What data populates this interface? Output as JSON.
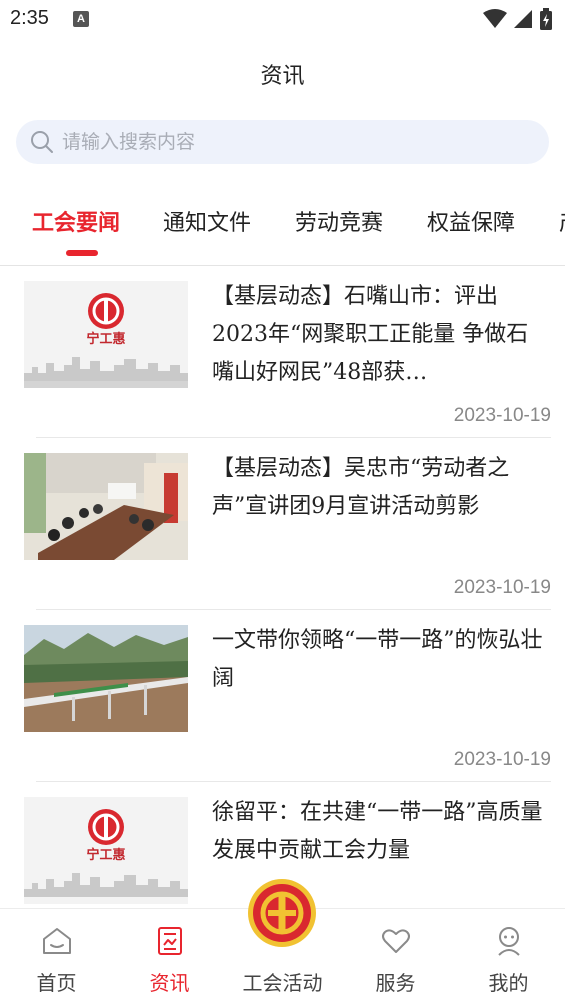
{
  "status_bar": {
    "time": "2:35",
    "badge": "A"
  },
  "header": {
    "title": "资讯"
  },
  "search": {
    "placeholder": "请输入搜索内容"
  },
  "tabs": [
    {
      "label": "工会要闻",
      "active": true
    },
    {
      "label": "通知文件",
      "active": false
    },
    {
      "label": "劳动竞赛",
      "active": false
    },
    {
      "label": "权益保障",
      "active": false
    },
    {
      "label": "产",
      "active": false
    }
  ],
  "news": [
    {
      "title": "【基层动态】石嘴山市：评出2023年“网聚职工正能量 争做石嘴山好网民”48部获…",
      "date": "2023-10-19",
      "image": "logo-placeholder",
      "logo_text": "宁工惠"
    },
    {
      "title": "【基层动态】吴忠市“劳动者之声”宣讲团9月宣讲活动剪影",
      "date": "2023-10-19",
      "image": "meeting-photo"
    },
    {
      "title": "一文带你领略“一带一路”的恢弘壮阔",
      "date": "2023-10-19",
      "image": "bridge-photo"
    },
    {
      "title": "徐留平：在共建“一带一路”高质量发展中贡献工会力量",
      "date": "",
      "image": "logo-placeholder",
      "logo_text": "宁工惠"
    }
  ],
  "bottom_nav": [
    {
      "label": "首页",
      "icon": "home-icon",
      "active": false
    },
    {
      "label": "资讯",
      "icon": "news-icon",
      "active": true
    },
    {
      "label": "工会活动",
      "icon": "union-emblem-icon",
      "active": false
    },
    {
      "label": "服务",
      "icon": "heart-icon",
      "active": false
    },
    {
      "label": "我的",
      "icon": "profile-icon",
      "active": false
    }
  ],
  "colors": {
    "accent": "#e8252e",
    "search_bg": "#eef2fb",
    "date": "#888888"
  }
}
